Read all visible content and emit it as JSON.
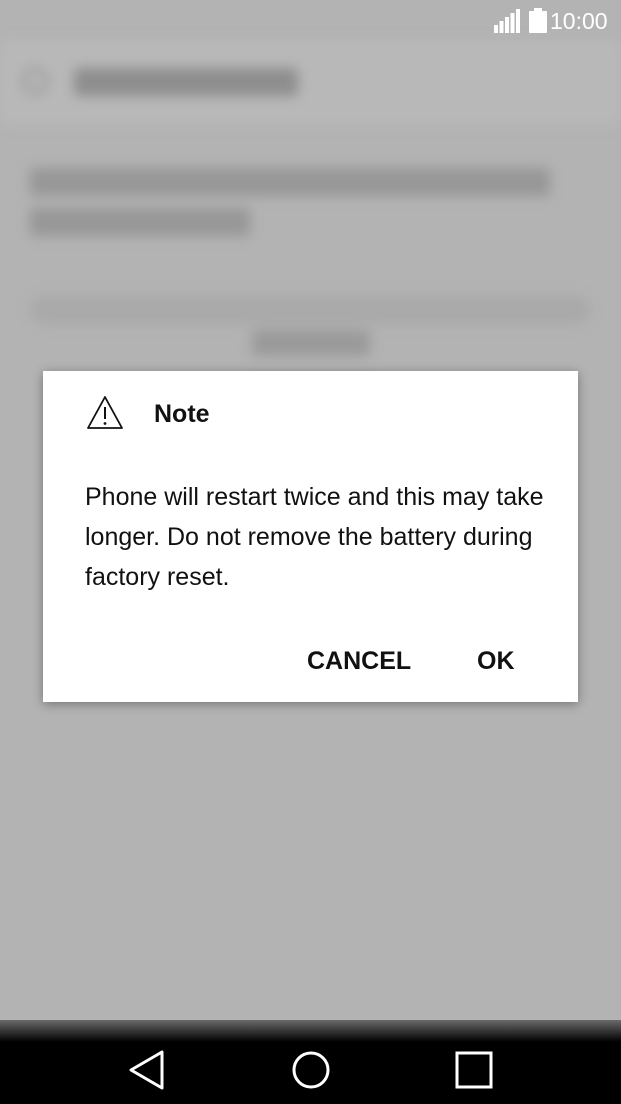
{
  "status_bar": {
    "time": "10:00",
    "icons": [
      "signal-icon",
      "battery-icon"
    ]
  },
  "dialog": {
    "icon": "warning-icon",
    "title": "Note",
    "message": "Phone will restart twice and this may take longer. Do not remove the battery during factory reset.",
    "buttons": {
      "cancel": "CANCEL",
      "ok": "OK"
    }
  },
  "nav_bar": {
    "icons": [
      "back-icon",
      "home-icon",
      "recent-apps-icon"
    ]
  },
  "colors": {
    "dialog_bg": "#ffffff",
    "scrim": "#aeaeae",
    "nav_bg": "#000000",
    "text": "#111111"
  }
}
